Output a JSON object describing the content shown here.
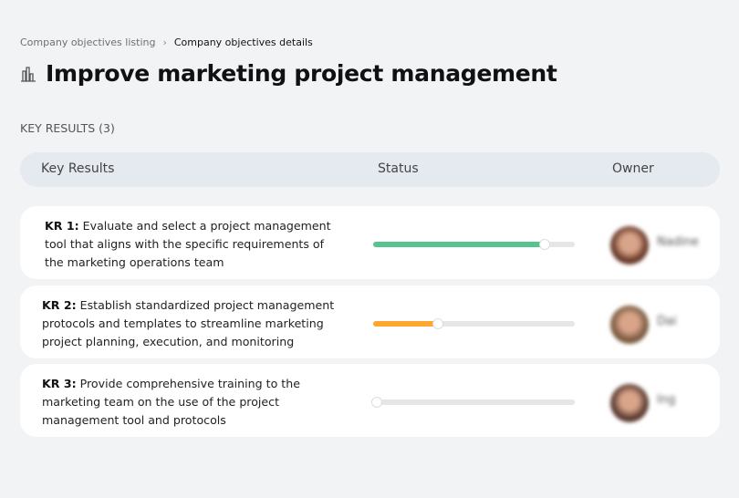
{
  "breadcrumb": {
    "parent": "Company objectives listing",
    "separator": "›",
    "current": "Company objectives details"
  },
  "title": "Improve marketing project management",
  "section_label": "KEY RESULTS (3)",
  "table_headers": {
    "key_results": "Key Results",
    "status": "Status",
    "owner": "Owner"
  },
  "rows": [
    {
      "id": "KR 1:",
      "text": "Evaluate and select a project management tool that aligns with the specific requirements of the marketing operations team",
      "progress": 85,
      "color": "#56c48c",
      "owner": "Nadine",
      "avatar": "#6a3a2a"
    },
    {
      "id": "KR 2:",
      "text": "Establish standardized project management protocols and templates to streamline marketing project planning, execution, and monitoring",
      "progress": 32,
      "color": "#ffa630",
      "owner": "Dai",
      "avatar": "#7a5a40"
    },
    {
      "id": "KR 3:",
      "text": "Provide comprehensive training to the marketing team on the use of the project management tool and protocols",
      "progress": 2,
      "color": "#f05a2a",
      "owner": "Ing",
      "avatar": "#5a3a30"
    }
  ]
}
